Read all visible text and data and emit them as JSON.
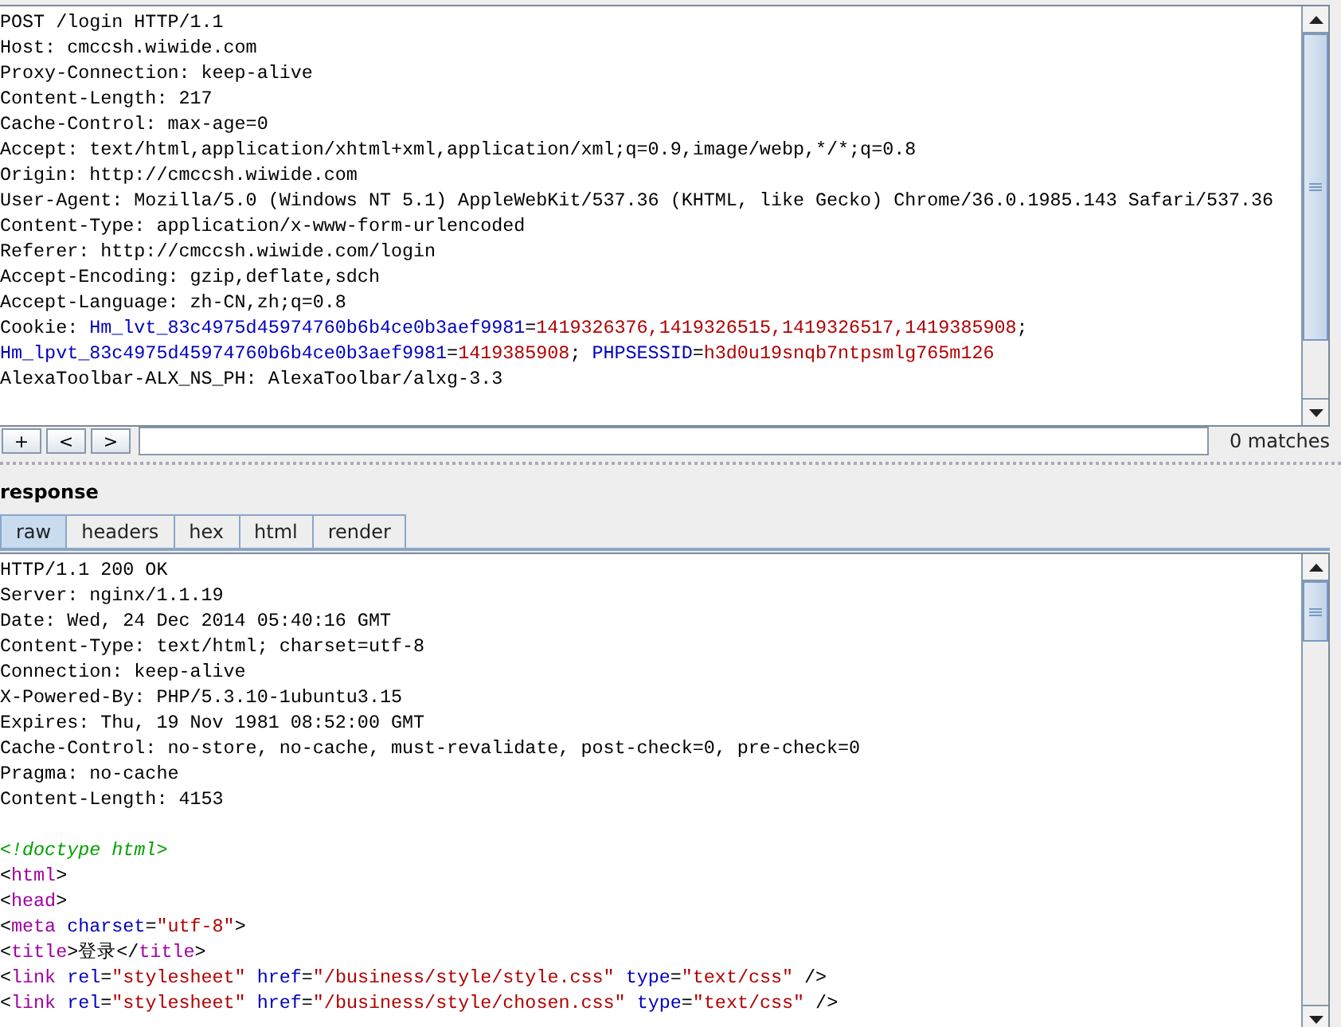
{
  "request": {
    "lines": [
      {
        "segments": [
          {
            "t": "POST /login HTTP/1.1",
            "kind": "plain"
          }
        ]
      },
      {
        "segments": [
          {
            "t": "Host: cmccsh.wiwide.com",
            "kind": "plain"
          }
        ]
      },
      {
        "segments": [
          {
            "t": "Proxy-Connection: keep-alive",
            "kind": "plain"
          }
        ]
      },
      {
        "segments": [
          {
            "t": "Content-Length: 217",
            "kind": "plain"
          }
        ]
      },
      {
        "segments": [
          {
            "t": "Cache-Control: max-age=0",
            "kind": "plain"
          }
        ]
      },
      {
        "segments": [
          {
            "t": "Accept: text/html,application/xhtml+xml,application/xml;q=0.9,image/webp,*/*;q=0.8",
            "kind": "plain"
          }
        ]
      },
      {
        "segments": [
          {
            "t": "Origin: http://cmccsh.wiwide.com",
            "kind": "plain"
          }
        ]
      },
      {
        "segments": [
          {
            "t": "User-Agent: Mozilla/5.0 (Windows NT 5.1) AppleWebKit/537.36 (KHTML, like Gecko) Chrome/36.0.1985.143 Safari/537.36",
            "kind": "plain"
          }
        ]
      },
      {
        "segments": [
          {
            "t": "Content-Type: application/x-www-form-urlencoded",
            "kind": "plain"
          }
        ]
      },
      {
        "segments": [
          {
            "t": "Referer: http://cmccsh.wiwide.com/login",
            "kind": "plain"
          }
        ]
      },
      {
        "segments": [
          {
            "t": "Accept-Encoding: gzip,deflate,sdch",
            "kind": "plain"
          }
        ]
      },
      {
        "segments": [
          {
            "t": "Accept-Language: zh-CN,zh;q=0.8",
            "kind": "plain"
          }
        ]
      },
      {
        "segments": [
          {
            "t": "Cookie: ",
            "kind": "plain"
          },
          {
            "t": "Hm_lvt_83c4975d45974760b6b4ce0b3aef9981",
            "kind": "name"
          },
          {
            "t": "=",
            "kind": "plain"
          },
          {
            "t": "1419326376,1419326515,1419326517,1419385908",
            "kind": "value"
          },
          {
            "t": ";",
            "kind": "plain"
          }
        ]
      },
      {
        "segments": [
          {
            "t": "Hm_lpvt_83c4975d45974760b6b4ce0b3aef9981",
            "kind": "name"
          },
          {
            "t": "=",
            "kind": "plain"
          },
          {
            "t": "1419385908",
            "kind": "value"
          },
          {
            "t": "; ",
            "kind": "plain"
          },
          {
            "t": "PHPSESSID",
            "kind": "name"
          },
          {
            "t": "=",
            "kind": "plain"
          },
          {
            "t": "h3d0u19snqb7ntpsmlg765m126",
            "kind": "value"
          }
        ]
      },
      {
        "segments": [
          {
            "t": "AlexaToolbar-ALX_NS_PH: AlexaToolbar/alxg-3.3",
            "kind": "plain"
          }
        ]
      }
    ]
  },
  "search": {
    "buttons": [
      "+",
      "<",
      ">"
    ],
    "matches": "0 matches"
  },
  "response": {
    "title": "response",
    "tabs": [
      {
        "label": "raw",
        "selected": true
      },
      {
        "label": "headers",
        "selected": false
      },
      {
        "label": "hex",
        "selected": false
      },
      {
        "label": "html",
        "selected": false
      },
      {
        "label": "render",
        "selected": false
      }
    ],
    "lines": [
      {
        "segments": [
          {
            "t": "HTTP/1.1 200 OK",
            "kind": "plain"
          }
        ]
      },
      {
        "segments": [
          {
            "t": "Server: nginx/1.1.19",
            "kind": "plain"
          }
        ]
      },
      {
        "segments": [
          {
            "t": "Date: Wed, 24 Dec 2014 05:40:16 GMT",
            "kind": "plain"
          }
        ]
      },
      {
        "segments": [
          {
            "t": "Content-Type: text/html; charset=utf-8",
            "kind": "plain"
          }
        ]
      },
      {
        "segments": [
          {
            "t": "Connection: keep-alive",
            "kind": "plain"
          }
        ]
      },
      {
        "segments": [
          {
            "t": "X-Powered-By: PHP/5.3.10-1ubuntu3.15",
            "kind": "plain"
          }
        ]
      },
      {
        "segments": [
          {
            "t": "Expires: Thu, 19 Nov 1981 08:52:00 GMT",
            "kind": "plain"
          }
        ]
      },
      {
        "segments": [
          {
            "t": "Cache-Control: no-store, no-cache, must-revalidate, post-check=0, pre-check=0",
            "kind": "plain"
          }
        ]
      },
      {
        "segments": [
          {
            "t": "Pragma: no-cache",
            "kind": "plain"
          }
        ]
      },
      {
        "segments": [
          {
            "t": "Content-Length: 4153",
            "kind": "plain"
          }
        ]
      },
      {
        "spaced": true,
        "segments": [
          {
            "t": "<!doctype html>",
            "kind": "comment"
          }
        ]
      },
      {
        "segments": [
          {
            "t": "<",
            "kind": "plain"
          },
          {
            "t": "html",
            "kind": "tag"
          },
          {
            "t": ">",
            "kind": "plain"
          }
        ]
      },
      {
        "segments": [
          {
            "t": "<",
            "kind": "plain"
          },
          {
            "t": "head",
            "kind": "tag"
          },
          {
            "t": ">",
            "kind": "plain"
          }
        ]
      },
      {
        "segments": [
          {
            "t": "<",
            "kind": "plain"
          },
          {
            "t": "meta ",
            "kind": "tag"
          },
          {
            "t": "charset",
            "kind": "attr"
          },
          {
            "t": "=",
            "kind": "plain"
          },
          {
            "t": "\"utf-8\"",
            "kind": "string"
          },
          {
            "t": ">",
            "kind": "plain"
          }
        ]
      },
      {
        "segments": [
          {
            "t": "<",
            "kind": "plain"
          },
          {
            "t": "title",
            "kind": "tag"
          },
          {
            "t": ">登录</",
            "kind": "plain"
          },
          {
            "t": "title",
            "kind": "tag"
          },
          {
            "t": ">",
            "kind": "plain"
          }
        ]
      },
      {
        "segments": [
          {
            "t": "<",
            "kind": "plain"
          },
          {
            "t": "link ",
            "kind": "tag"
          },
          {
            "t": "rel",
            "kind": "attr"
          },
          {
            "t": "=",
            "kind": "plain"
          },
          {
            "t": "\"stylesheet\" ",
            "kind": "string"
          },
          {
            "t": "href",
            "kind": "attr"
          },
          {
            "t": "=",
            "kind": "plain"
          },
          {
            "t": "\"/business/style/style.css\" ",
            "kind": "string"
          },
          {
            "t": "type",
            "kind": "attr"
          },
          {
            "t": "=",
            "kind": "plain"
          },
          {
            "t": "\"text/css\"",
            "kind": "string"
          },
          {
            "t": " />",
            "kind": "plain"
          }
        ]
      },
      {
        "segments": [
          {
            "t": "<",
            "kind": "plain"
          },
          {
            "t": "link ",
            "kind": "tag"
          },
          {
            "t": "rel",
            "kind": "attr"
          },
          {
            "t": "=",
            "kind": "plain"
          },
          {
            "t": "\"stylesheet\" ",
            "kind": "string"
          },
          {
            "t": "href",
            "kind": "attr"
          },
          {
            "t": "=",
            "kind": "plain"
          },
          {
            "t": "\"/business/style/chosen.css\" ",
            "kind": "string"
          },
          {
            "t": "type",
            "kind": "attr"
          },
          {
            "t": "=",
            "kind": "plain"
          },
          {
            "t": "\"text/css\"",
            "kind": "string"
          },
          {
            "t": " />",
            "kind": "plain"
          }
        ]
      }
    ]
  }
}
